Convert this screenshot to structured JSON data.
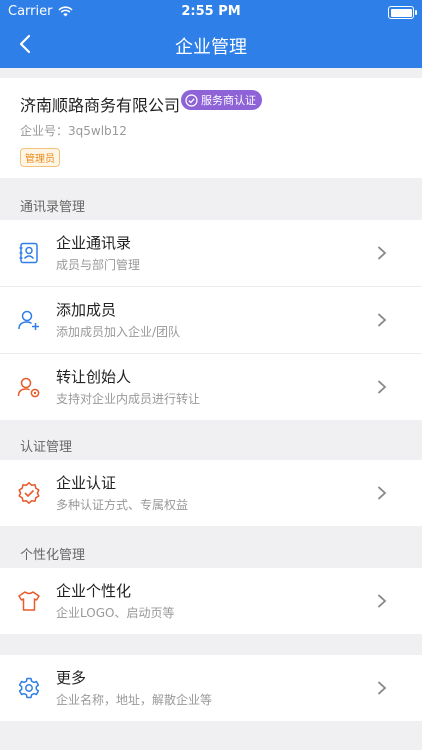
{
  "status_bar": {
    "carrier": "Carrier",
    "time": "2:55 PM"
  },
  "nav": {
    "title": "企业管理"
  },
  "company": {
    "name": "济南顺路商务有限公司",
    "badge": "服务商认证",
    "id_label": "企业号：",
    "id_value": "3q5wlb12",
    "role": "管理员"
  },
  "sections": {
    "contacts": "通讯录管理",
    "auth": "认证管理",
    "personalize": "个性化管理"
  },
  "rows": {
    "directory": {
      "title": "企业通讯录",
      "subtitle": "成员与部门管理"
    },
    "add_member": {
      "title": "添加成员",
      "subtitle": "添加成员加入企业/团队"
    },
    "transfer": {
      "title": "转让创始人",
      "subtitle": "支持对企业内成员进行转让"
    },
    "certify": {
      "title": "企业认证",
      "subtitle": "多种认证方式、专属权益"
    },
    "customize": {
      "title": "企业个性化",
      "subtitle": "企业LOGO、启动页等"
    },
    "more": {
      "title": "更多",
      "subtitle": "企业名称，地址，解散企业等"
    }
  },
  "colors": {
    "nav_bg": "#2f7fe8",
    "badge_bg": "#8e63d8",
    "icon_blue": "#2f7fe8",
    "icon_orange": "#e85a2a"
  }
}
